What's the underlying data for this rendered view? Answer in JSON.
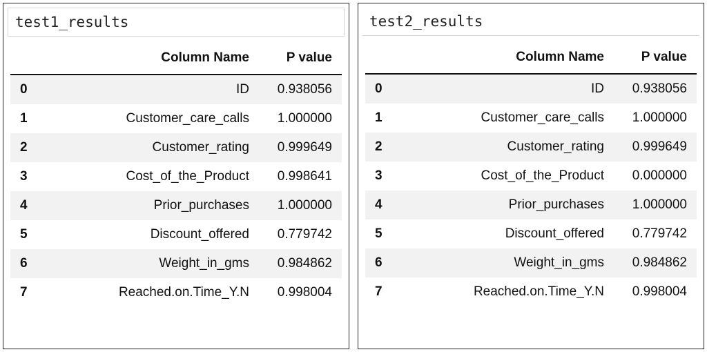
{
  "left": {
    "title": "test1_results",
    "columns": {
      "c0": "Column Name",
      "c1": "P value"
    },
    "rows": [
      {
        "idx": "0",
        "name": "ID",
        "p": "0.938056"
      },
      {
        "idx": "1",
        "name": "Customer_care_calls",
        "p": "1.000000"
      },
      {
        "idx": "2",
        "name": "Customer_rating",
        "p": "0.999649"
      },
      {
        "idx": "3",
        "name": "Cost_of_the_Product",
        "p": "0.998641"
      },
      {
        "idx": "4",
        "name": "Prior_purchases",
        "p": "1.000000"
      },
      {
        "idx": "5",
        "name": "Discount_offered",
        "p": "0.779742"
      },
      {
        "idx": "6",
        "name": "Weight_in_gms",
        "p": "0.984862"
      },
      {
        "idx": "7",
        "name": "Reached.on.Time_Y.N",
        "p": "0.998004"
      }
    ]
  },
  "right": {
    "title": "test2_results",
    "columns": {
      "c0": "Column Name",
      "c1": "P value"
    },
    "rows": [
      {
        "idx": "0",
        "name": "ID",
        "p": "0.938056"
      },
      {
        "idx": "1",
        "name": "Customer_care_calls",
        "p": "1.000000"
      },
      {
        "idx": "2",
        "name": "Customer_rating",
        "p": "0.999649"
      },
      {
        "idx": "3",
        "name": "Cost_of_the_Product",
        "p": "0.000000"
      },
      {
        "idx": "4",
        "name": "Prior_purchases",
        "p": "1.000000"
      },
      {
        "idx": "5",
        "name": "Discount_offered",
        "p": "0.779742"
      },
      {
        "idx": "6",
        "name": "Weight_in_gms",
        "p": "0.984862"
      },
      {
        "idx": "7",
        "name": "Reached.on.Time_Y.N",
        "p": "0.998004"
      }
    ]
  }
}
